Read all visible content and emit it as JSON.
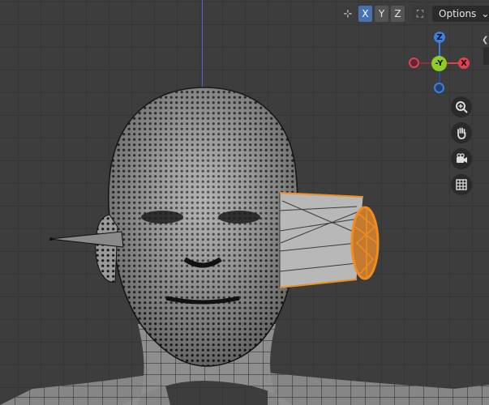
{
  "header": {
    "axis_buttons": [
      {
        "label": "X",
        "active": true
      },
      {
        "label": "Y",
        "active": false
      },
      {
        "label": "Z",
        "active": false
      }
    ],
    "options_label": "Options",
    "options_chevron": "⌄"
  },
  "gizmo": {
    "top_label": "Z",
    "center_label": "-Y",
    "right_label": "X",
    "colors": {
      "x": "#e5404e",
      "y": "#8fce1f",
      "z": "#3b7fe0"
    }
  },
  "tools": [
    "zoom-icon",
    "hand-pan-icon",
    "camera-icon",
    "grid-icon"
  ],
  "colors": {
    "selection": "#f18d1e",
    "background": "#3d3d3d",
    "axis_z": "#3f6fd4"
  }
}
